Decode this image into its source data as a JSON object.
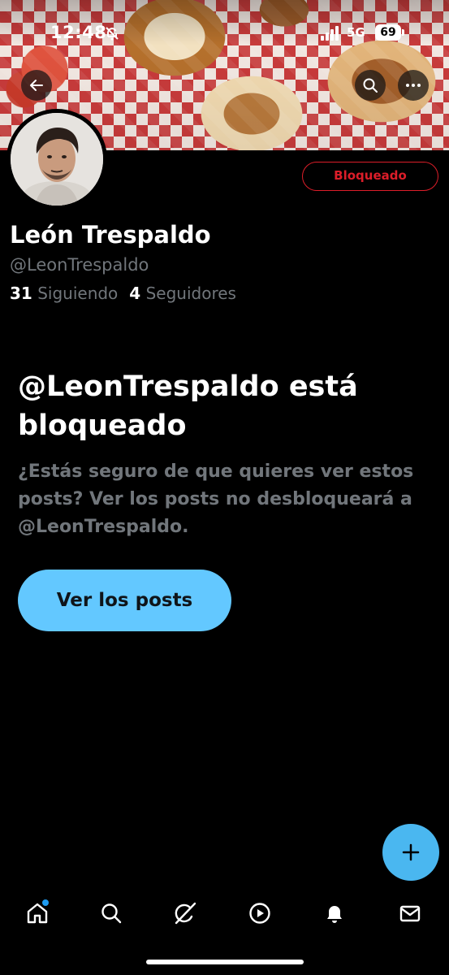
{
  "status_bar": {
    "time": "12:48",
    "network": "5G",
    "battery": "69"
  },
  "profile": {
    "display_name": "León Trespaldo",
    "handle": "@LeonTrespaldo",
    "following_count": "31",
    "following_label": "Siguiendo",
    "followers_count": "4",
    "followers_label": "Seguidores",
    "blocked_button_label": "Bloqueado"
  },
  "blocked_notice": {
    "title": "@LeonTrespaldo está bloqueado",
    "description": "¿Estás seguro de que quieres ver estos posts? Ver los posts no desbloqueará a @LeonTrespaldo.",
    "view_posts_label": "Ver los posts"
  },
  "colors": {
    "accent_blue": "#1d9bf0",
    "blocked_red": "#f4212e",
    "view_button": "#63c8ff",
    "secondary_text": "#71767b"
  },
  "icons": {
    "banner": [
      "back-arrow-icon",
      "search-icon",
      "more-icon"
    ],
    "fab": "plus-icon",
    "bottom_nav": [
      "home-icon",
      "search-icon",
      "grok-icon",
      "video-icon",
      "bell-icon",
      "mail-icon"
    ]
  }
}
